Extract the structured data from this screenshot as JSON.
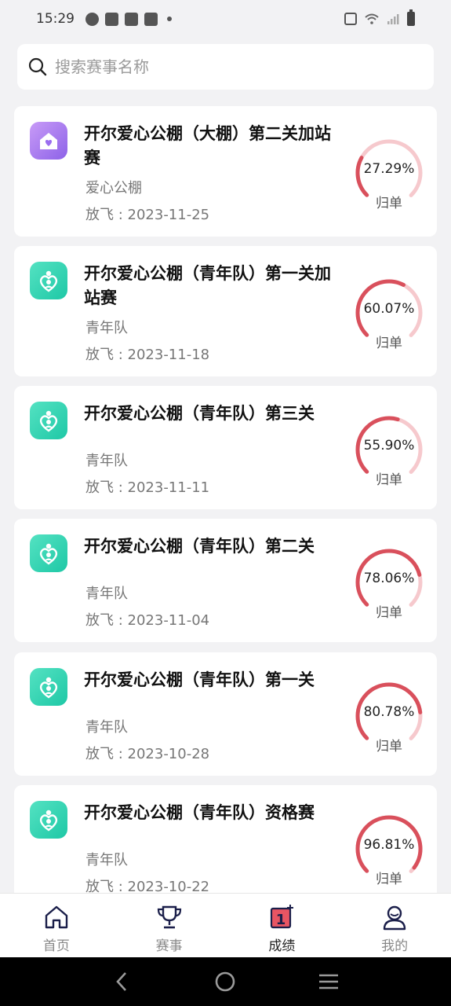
{
  "status_bar": {
    "time": "15:29"
  },
  "search": {
    "placeholder": "搜索赛事名称"
  },
  "races": [
    {
      "title": "开尔爱心公棚（大棚）第二关加站赛",
      "team": "爱心公棚",
      "date": "放飞 : 2023-11-25",
      "percent": "27.29%",
      "ratio": 0.2729,
      "label": "归单",
      "icon": "house-heart-icon",
      "icon_color": "purple"
    },
    {
      "title": "开尔爱心公棚（青年队）第一关加站赛",
      "team": "青年队",
      "date": "放飞 : 2023-11-18",
      "percent": "60.07%",
      "ratio": 0.6007,
      "label": "归单",
      "icon": "heart-person-icon",
      "icon_color": "green"
    },
    {
      "title": "开尔爱心公棚（青年队）第三关",
      "team": "青年队",
      "date": "放飞 : 2023-11-11",
      "percent": "55.90%",
      "ratio": 0.559,
      "label": "归单",
      "icon": "heart-person-icon",
      "icon_color": "green"
    },
    {
      "title": "开尔爱心公棚（青年队）第二关",
      "team": "青年队",
      "date": "放飞 : 2023-11-04",
      "percent": "78.06%",
      "ratio": 0.7806,
      "label": "归单",
      "icon": "heart-person-icon",
      "icon_color": "green"
    },
    {
      "title": "开尔爱心公棚（青年队）第一关",
      "team": "青年队",
      "date": "放飞 : 2023-10-28",
      "percent": "80.78%",
      "ratio": 0.8078,
      "label": "归单",
      "icon": "heart-person-icon",
      "icon_color": "green"
    },
    {
      "title": "开尔爱心公棚（青年队）资格赛",
      "team": "青年队",
      "date": "放飞 : 2023-10-22",
      "percent": "96.81%",
      "ratio": 0.9681,
      "label": "归单",
      "icon": "heart-person-icon",
      "icon_color": "green"
    }
  ],
  "colors": {
    "gauge_fg": "#d9505c",
    "gauge_bg": "#f6c9cd"
  },
  "nav": {
    "items": [
      {
        "label": "首页",
        "icon": "home-icon"
      },
      {
        "label": "赛事",
        "icon": "trophy-icon"
      },
      {
        "label": "成绩",
        "icon": "ranking-icon",
        "active": true
      },
      {
        "label": "我的",
        "icon": "profile-icon"
      }
    ]
  }
}
